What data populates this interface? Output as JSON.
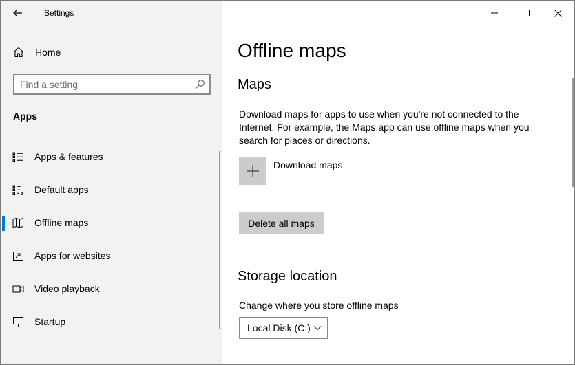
{
  "window": {
    "title": "Settings"
  },
  "sidebar": {
    "home_label": "Home",
    "search": {
      "placeholder": "Find a setting"
    },
    "section_label": "Apps",
    "items": [
      {
        "label": "Apps & features",
        "icon": "apps-features-icon"
      },
      {
        "label": "Default apps",
        "icon": "default-apps-icon"
      },
      {
        "label": "Offline maps",
        "icon": "offline-maps-icon",
        "active": true
      },
      {
        "label": "Apps for websites",
        "icon": "apps-for-websites-icon"
      },
      {
        "label": "Video playback",
        "icon": "video-playback-icon"
      },
      {
        "label": "Startup",
        "icon": "startup-icon"
      }
    ]
  },
  "main": {
    "title": "Offline maps",
    "maps_section": {
      "heading": "Maps",
      "description": "Download maps for apps to use when you're not connected to the Internet. For example, the Maps app can use offline maps when you search for places or directions.",
      "download_label": "Download maps",
      "delete_label": "Delete all maps"
    },
    "storage_section": {
      "heading": "Storage location",
      "label": "Change where you store offline maps",
      "selected": "Local Disk (C:)"
    }
  },
  "colors": {
    "accent": "#0078d7",
    "sidebar_bg": "#f2f2f2",
    "button_bg": "#cccccc"
  }
}
